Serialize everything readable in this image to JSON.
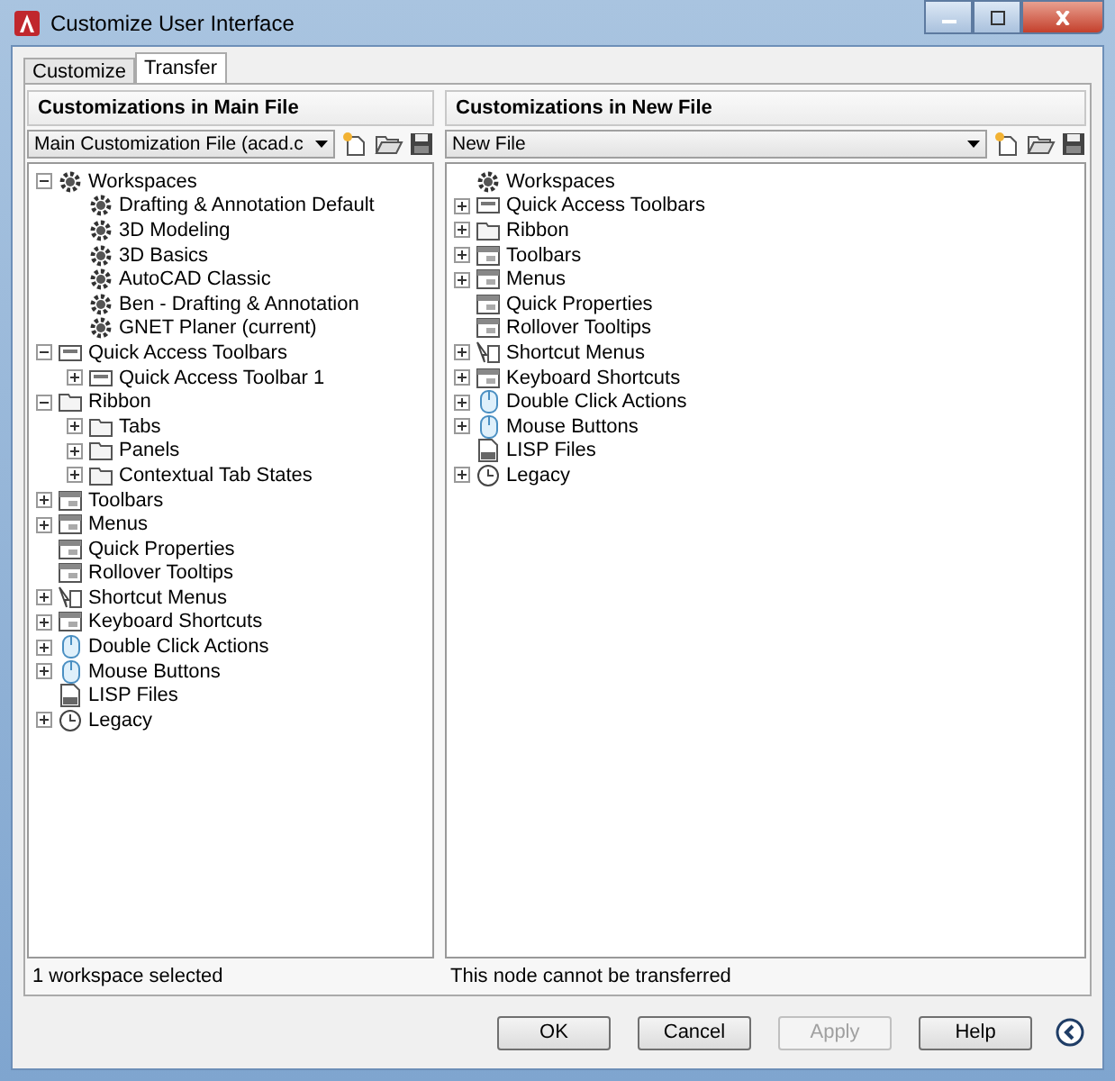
{
  "window": {
    "title": "Customize User Interface"
  },
  "tabs": [
    {
      "label": "Customize",
      "selected": false
    },
    {
      "label": "Transfer",
      "selected": true
    }
  ],
  "main_panel": {
    "heading": "Customizations in Main File",
    "file": "Main Customization File (acad.c",
    "status": "1 workspace selected",
    "tree": [
      {
        "label": "Workspaces",
        "kind": "workspaces",
        "expanded": true,
        "children": [
          {
            "label": "Drafting & Annotation Default",
            "kind": "workspace"
          },
          {
            "label": "3D Modeling",
            "kind": "workspace"
          },
          {
            "label": "3D Basics",
            "kind": "workspace"
          },
          {
            "label": "AutoCAD Classic",
            "kind": "workspace"
          },
          {
            "label": "Ben - Drafting & Annotation",
            "kind": "workspace"
          },
          {
            "label": "GNET Planer (current)",
            "kind": "workspace"
          }
        ]
      },
      {
        "label": "Quick Access Toolbars",
        "kind": "toolbar",
        "expanded": true,
        "children": [
          {
            "label": "Quick Access Toolbar 1",
            "kind": "toolbar",
            "expanded": false
          }
        ]
      },
      {
        "label": "Ribbon",
        "kind": "folder",
        "expanded": true,
        "children": [
          {
            "label": "Tabs",
            "kind": "folder",
            "expanded": false
          },
          {
            "label": "Panels",
            "kind": "folder",
            "expanded": false
          },
          {
            "label": "Contextual Tab States",
            "kind": "folder",
            "expanded": false
          }
        ]
      },
      {
        "label": "Toolbars",
        "kind": "window",
        "expanded": false
      },
      {
        "label": "Menus",
        "kind": "window",
        "expanded": false
      },
      {
        "label": "Quick Properties",
        "kind": "window"
      },
      {
        "label": "Rollover Tooltips",
        "kind": "window"
      },
      {
        "label": "Shortcut Menus",
        "kind": "pointer",
        "expanded": false
      },
      {
        "label": "Keyboard Shortcuts",
        "kind": "window",
        "expanded": false
      },
      {
        "label": "Double Click Actions",
        "kind": "mouse",
        "expanded": false
      },
      {
        "label": "Mouse Buttons",
        "kind": "mouse",
        "expanded": false
      },
      {
        "label": "LISP Files",
        "kind": "document"
      },
      {
        "label": "Legacy",
        "kind": "clock",
        "expanded": false
      }
    ]
  },
  "new_panel": {
    "heading": "Customizations in New File",
    "file": "New File",
    "status": "This node cannot be transferred",
    "tree": [
      {
        "label": "Workspaces",
        "kind": "workspaces"
      },
      {
        "label": "Quick Access Toolbars",
        "kind": "toolbar",
        "expanded": false
      },
      {
        "label": "Ribbon",
        "kind": "folder",
        "expanded": false
      },
      {
        "label": "Toolbars",
        "kind": "window",
        "expanded": false
      },
      {
        "label": "Menus",
        "kind": "window",
        "expanded": false
      },
      {
        "label": "Quick Properties",
        "kind": "window"
      },
      {
        "label": "Rollover Tooltips",
        "kind": "window"
      },
      {
        "label": "Shortcut Menus",
        "kind": "pointer",
        "expanded": false
      },
      {
        "label": "Keyboard Shortcuts",
        "kind": "window",
        "expanded": false
      },
      {
        "label": "Double Click Actions",
        "kind": "mouse",
        "expanded": false
      },
      {
        "label": "Mouse Buttons",
        "kind": "mouse",
        "expanded": false
      },
      {
        "label": "LISP Files",
        "kind": "document"
      },
      {
        "label": "Legacy",
        "kind": "clock",
        "expanded": false
      }
    ]
  },
  "buttons": [
    {
      "label": "OK",
      "disabled": false
    },
    {
      "label": "Cancel",
      "disabled": false
    },
    {
      "label": "Apply",
      "disabled": true
    },
    {
      "label": "Help",
      "disabled": false
    }
  ]
}
